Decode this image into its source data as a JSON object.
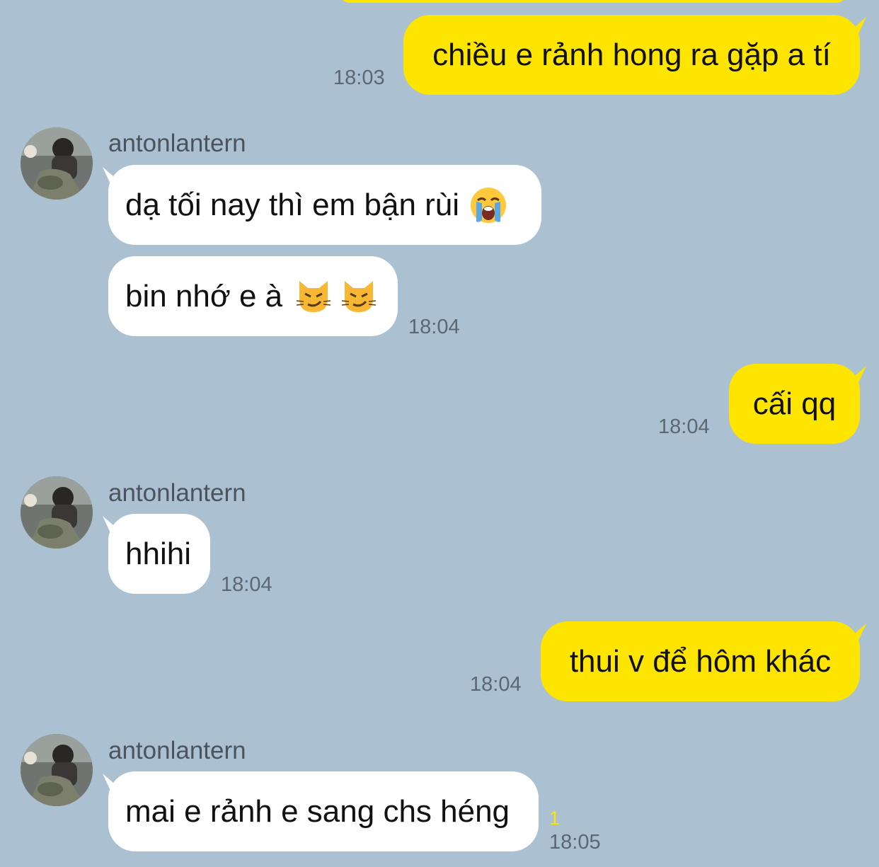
{
  "messages": [
    {
      "side": "out",
      "text": "chiều e rảnh hong ra gặp a tí",
      "time": "18:03"
    },
    {
      "side": "in",
      "sender": "antonlantern",
      "text": "dạ tối nay thì em bận rùi",
      "emojis": [
        "loudly-crying-face"
      ]
    },
    {
      "side": "in",
      "text": "bin nhớ e à",
      "emojis": [
        "cat-with-wry-smile",
        "cat-with-wry-smile"
      ],
      "time": "18:04"
    },
    {
      "side": "out",
      "text": "cấi qq",
      "time": "18:04"
    },
    {
      "side": "in",
      "sender": "antonlantern",
      "text": "hhihi",
      "time": "18:04"
    },
    {
      "side": "out",
      "text": "thui v để hôm khác",
      "time": "18:04"
    },
    {
      "side": "in",
      "sender": "antonlantern",
      "text": "mai e rảnh e sang chs héng",
      "time": "18:05",
      "unread": "1"
    }
  ],
  "colors": {
    "background": "#abc1d1",
    "outgoing_bubble": "#fee500",
    "incoming_bubble": "#ffffff",
    "timestamp": "#5b6772",
    "sender_name": "#4b545c",
    "unread_count": "#fee500"
  }
}
